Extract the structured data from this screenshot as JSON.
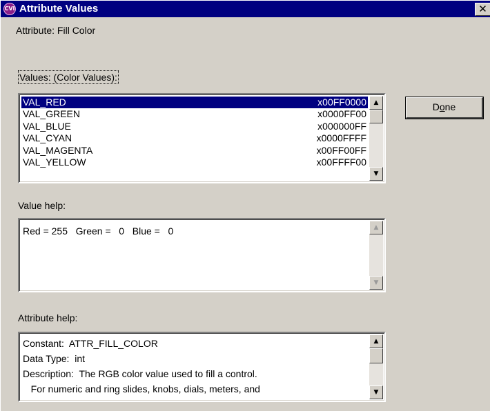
{
  "window": {
    "title": "Attribute Values",
    "icon_label": "CVI",
    "close_glyph": "✕"
  },
  "attribute": {
    "label": "Attribute:  Fill Color"
  },
  "values": {
    "label": "Values: (Color Values):",
    "selected_index": 0,
    "items": [
      {
        "name": "VAL_RED",
        "value": "x00FF0000"
      },
      {
        "name": "VAL_GREEN",
        "value": "x0000FF00"
      },
      {
        "name": "VAL_BLUE",
        "value": "x000000FF"
      },
      {
        "name": "VAL_CYAN",
        "value": "x0000FFFF"
      },
      {
        "name": "VAL_MAGENTA",
        "value": "x00FF00FF"
      },
      {
        "name": "VAL_YELLOW",
        "value": "x00FFFF00"
      }
    ]
  },
  "done_button": {
    "label_prefix": "D",
    "label_mnemonic": "o",
    "label_suffix": "ne"
  },
  "value_help": {
    "label": "Value help:",
    "text": "Red = 255   Green =   0   Blue =   0"
  },
  "attribute_help": {
    "label": "Attribute help:",
    "lines": [
      "Constant:  ATTR_FILL_COLOR",
      "Data Type:  int",
      "Description:  The RGB color value used to fill a control.",
      "   For numeric and ring slides, knobs, dials, meters, and"
    ]
  },
  "scroll_glyphs": {
    "up": "▲",
    "down": "▼"
  },
  "colors": {
    "titlebar": "#000080",
    "selection": "#000080",
    "face": "#d4d0c8"
  }
}
